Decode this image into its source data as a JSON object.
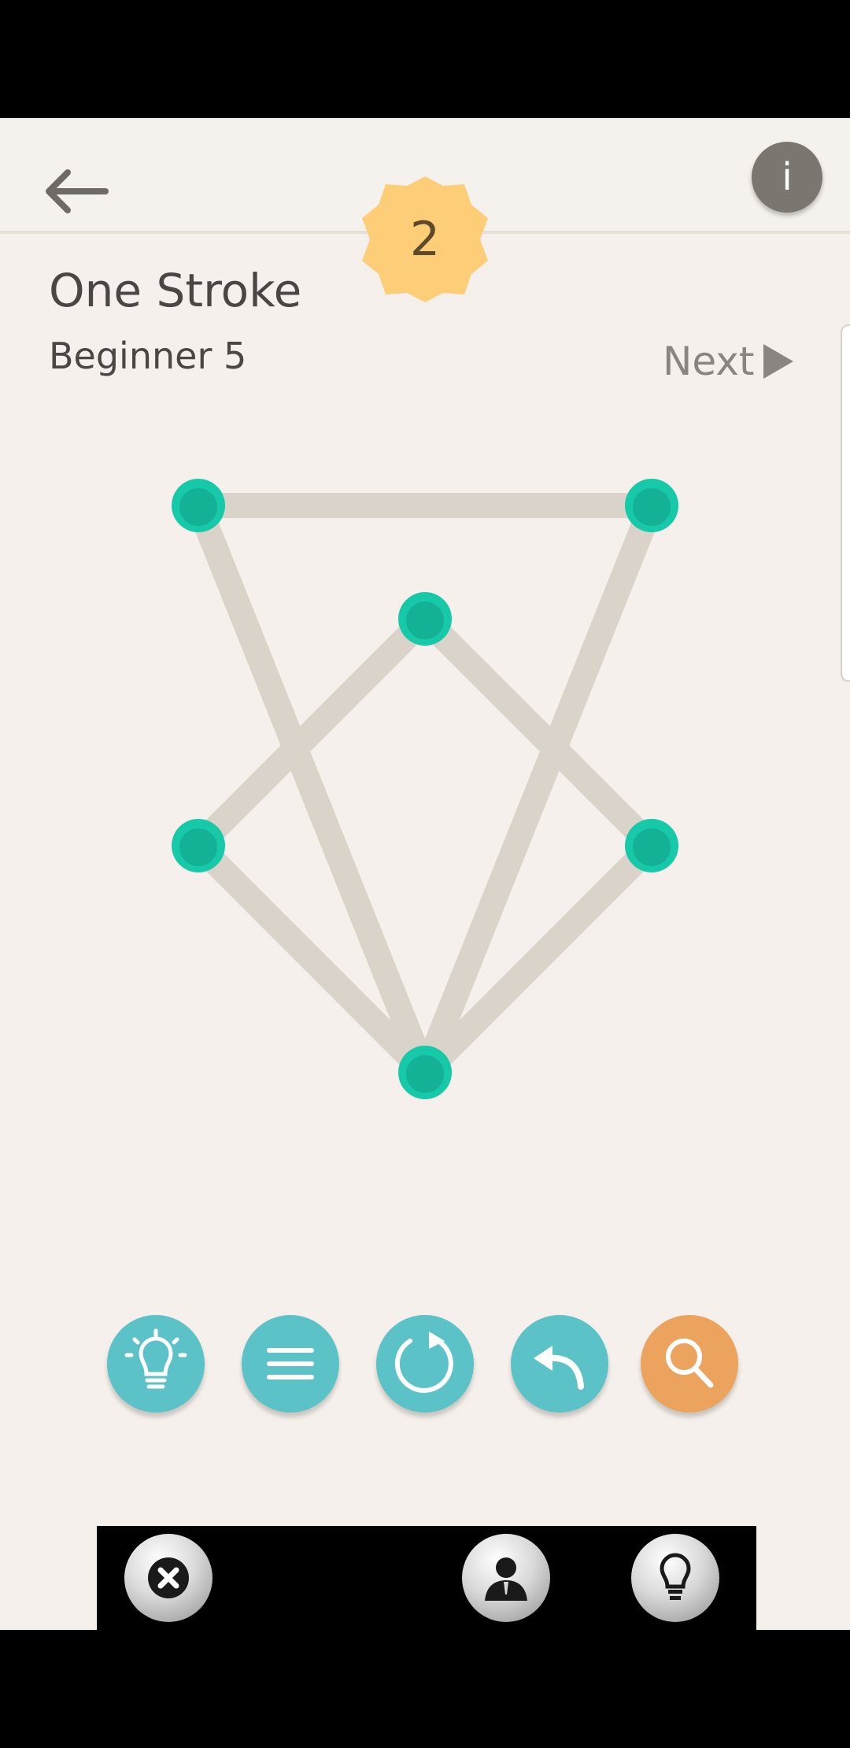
{
  "header": {
    "badge_count": "2",
    "info_label": "i"
  },
  "puzzle": {
    "title": "One Stroke",
    "level": "Beginner 5",
    "next_label": "Next"
  },
  "colors": {
    "node": "#16c9a9",
    "node_dark": "#13b296",
    "edge": "#d9d3ca",
    "tool_teal": "#5bc3c8",
    "tool_orange": "#eba35e",
    "badge": "#fdcd78"
  },
  "toolbar": {
    "icons": [
      "lightbulb-icon",
      "menu-icon",
      "restart-icon",
      "undo-icon",
      "zoom-icon"
    ]
  },
  "ad": {
    "icons": [
      "close-icon",
      "person-icon",
      "lightbulb-icon"
    ]
  }
}
